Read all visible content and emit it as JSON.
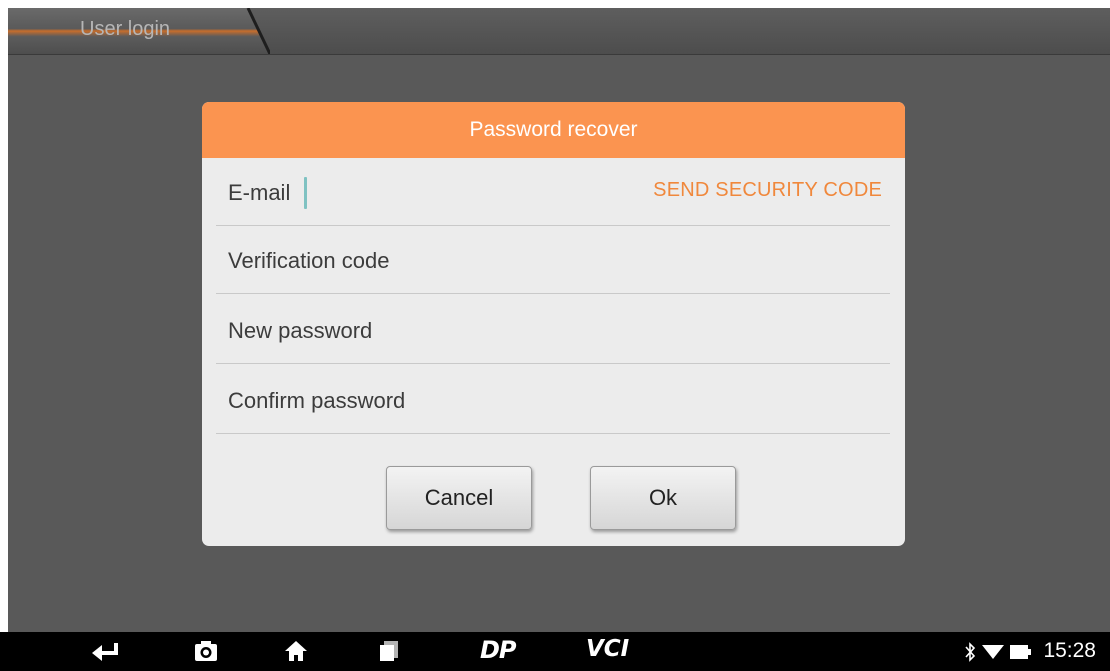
{
  "tab": {
    "label": "User login"
  },
  "dialog": {
    "title": "Password recover",
    "send_code_label": "SEND SECURITY CODE",
    "fields": {
      "email": "E-mail",
      "verification": "Verification code",
      "new_password": "New password",
      "confirm_password": "Confirm password"
    },
    "buttons": {
      "cancel": "Cancel",
      "ok": "Ok"
    }
  },
  "navbar": {
    "icons": [
      "back-icon",
      "camera-icon",
      "home-icon",
      "recent-apps-icon",
      "dp-icon",
      "vci-icon",
      "bluetooth-icon",
      "wifi-icon",
      "battery-icon"
    ],
    "dp_text": "DP",
    "vci_text": "VCI",
    "time": "15:28"
  },
  "colors": {
    "accent": "#fb9450",
    "link": "#f0883c",
    "background": "#595959",
    "dialog": "#ececec"
  }
}
